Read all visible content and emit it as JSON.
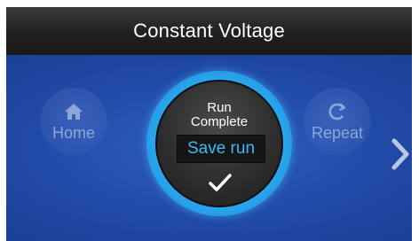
{
  "header": {
    "title": "Constant Voltage"
  },
  "home_button": {
    "label": "Home",
    "icon": "home-icon"
  },
  "repeat_button": {
    "label": "Repeat",
    "icon": "refresh-icon"
  },
  "center": {
    "status_line1": "Run",
    "status_line2": "Complete",
    "save_label": "Save run",
    "confirm_icon": "checkmark-icon"
  },
  "next_icon": "chevron-right-icon",
  "colors": {
    "header_bg": "#222222",
    "body_bg": "#214ba8",
    "accent_ring": "#2aa8ef",
    "save_text": "#3ab8f5",
    "side_button_text": "#8ea6d6"
  }
}
